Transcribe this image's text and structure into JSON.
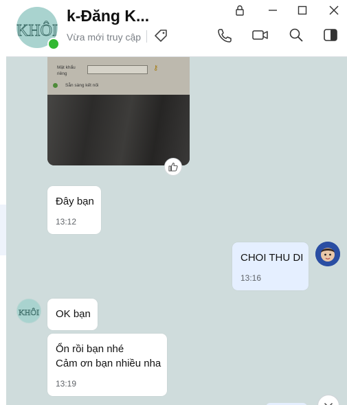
{
  "header": {
    "avatar_text": "KHÔI",
    "title": "k-Đăng K...",
    "status": "Vừa mới truy cập",
    "icons": [
      "pin-icon",
      "minimize-icon",
      "maximize-icon",
      "close-icon",
      "tag-icon",
      "phone-icon",
      "video-icon",
      "search-icon",
      "sidebar-toggle-icon"
    ]
  },
  "photo": {
    "label_password": "Mật khẩu",
    "label_password2": "riêng",
    "label_remember": "Sẵn sàng kết nối"
  },
  "messages": [
    {
      "direction": "in",
      "text": "Đây bạn",
      "time": "13:12"
    },
    {
      "direction": "out",
      "text": "CHOI THU DI",
      "time": "13:16"
    },
    {
      "direction": "in",
      "text": "OK bạn",
      "time": ""
    },
    {
      "direction": "in",
      "text": "Ổn rồi bạn nhé",
      "text2": "Cảm ơn bạn nhiều nha",
      "time": "13:19"
    }
  ],
  "colors": {
    "chat_bg": "#cfdcdc",
    "incoming_bubble": "#ffffff",
    "outgoing_bubble": "#e5efff",
    "online": "#33b833"
  }
}
